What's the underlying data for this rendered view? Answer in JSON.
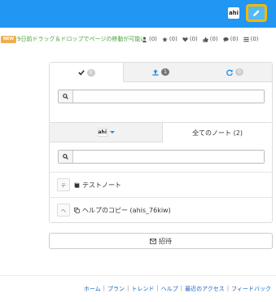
{
  "header": {
    "avatar_text": "ahi",
    "edit_icon": "pencil-icon",
    "accent_color": "#2196f3",
    "highlight_color": "#f5b800"
  },
  "status": {
    "new_badge": "NEW",
    "news_text": "9日前ドラッグ＆ドロップでページの移動が可能に",
    "counts": [
      {
        "icon": "user-icon",
        "value": "(0)"
      },
      {
        "icon": "star-icon",
        "value": "(0)"
      },
      {
        "icon": "heart-icon",
        "value": "(0)"
      },
      {
        "icon": "thumbs-up-icon",
        "value": "(0)"
      },
      {
        "icon": "comment-icon",
        "value": "(0)"
      },
      {
        "icon": "list-icon",
        "value": "(0)"
      }
    ]
  },
  "panel1": {
    "tabs": [
      {
        "icon": "check-icon",
        "badge": "0"
      },
      {
        "icon": "upload-icon",
        "badge": "1"
      },
      {
        "icon": "refresh-icon",
        "badge": "0"
      }
    ],
    "search_value": ""
  },
  "panel2": {
    "tab_avatar": "ahi",
    "tab_all_notes": "全てのノート (2)",
    "search_value": "",
    "notes": [
      {
        "thumb_text": "テ",
        "label": "テストノート"
      },
      {
        "thumb_text": "ヘ",
        "label": "ヘルプのコピー (ahis_76kiw)"
      }
    ]
  },
  "invite": {
    "label": "招待"
  },
  "footer": {
    "links": [
      "ホーム",
      "プラン",
      "トレンド",
      "ヘルプ",
      "最近のアクセス",
      "フィードバック"
    ]
  }
}
